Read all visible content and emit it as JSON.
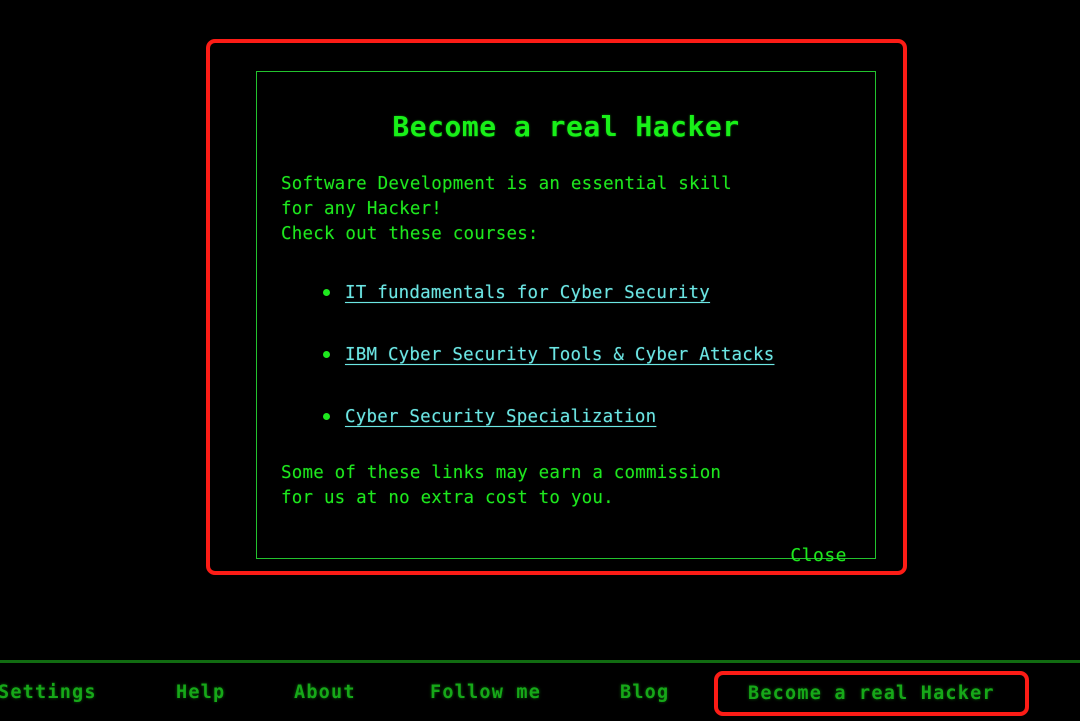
{
  "theme": {
    "background": "#000000",
    "primary_green": "#1ee81e",
    "dim_green": "#16a818",
    "border_green": "#22c32e",
    "link_cyan": "#6ce6e4",
    "highlight_red": "#fc1c16"
  },
  "modal": {
    "title": "Become a real Hacker",
    "intro_lines": "Software Development is an essential skill\nfor any Hacker!\nCheck out these courses:",
    "courses": [
      {
        "label": "IT fundamentals for Cyber Security"
      },
      {
        "label": "IBM Cyber Security Tools & Cyber Attacks"
      },
      {
        "label": "Cyber Security Specialization"
      }
    ],
    "disclaimer_lines": "Some of these links may earn a commission\nfor us at no extra cost to you.",
    "close_label": "Close"
  },
  "bottom_nav": {
    "items": [
      {
        "label": "Settings",
        "highlighted": false
      },
      {
        "label": "Help",
        "highlighted": false
      },
      {
        "label": "About",
        "highlighted": false
      },
      {
        "label": "Follow me",
        "highlighted": false
      },
      {
        "label": "Blog",
        "highlighted": false
      },
      {
        "label": "Become a real Hacker",
        "highlighted": true
      }
    ]
  }
}
